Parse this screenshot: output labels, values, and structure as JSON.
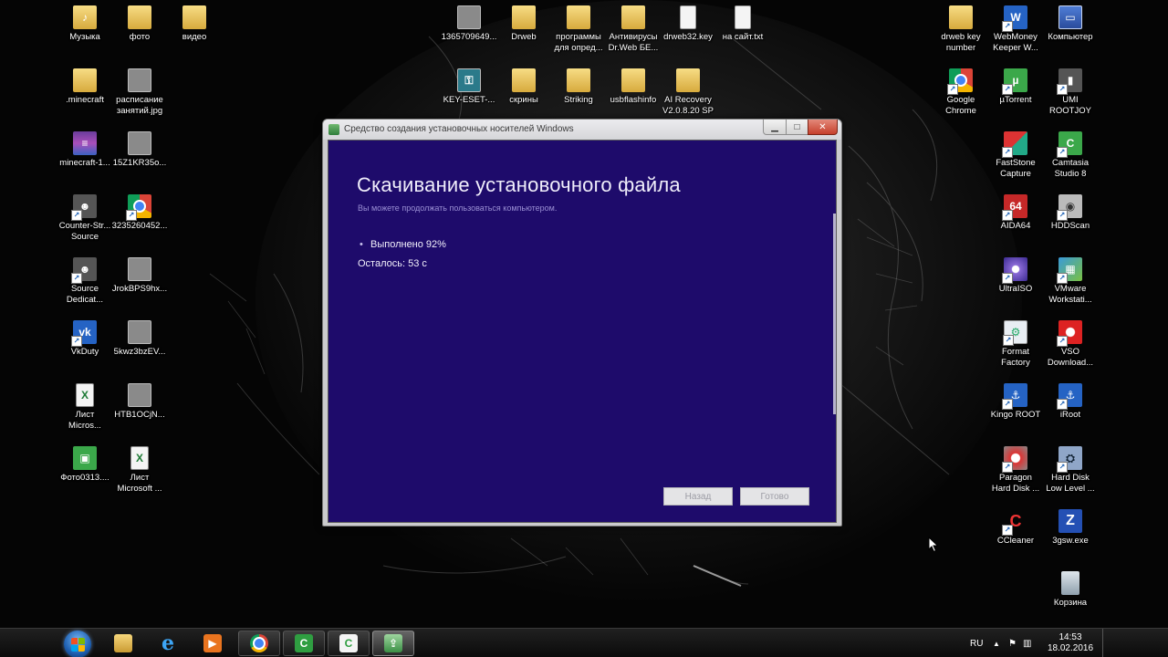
{
  "desktop": {
    "left_column_1": [
      {
        "label": "Музыка",
        "icon": "music-folder-icon"
      },
      {
        "label": ".minecraft",
        "icon": "folder-icon"
      },
      {
        "label": "minecraft-1...",
        "icon": "winrar-archive-icon"
      },
      {
        "label": "Counter-Str...\nSource",
        "icon": "counter-strike-icon"
      },
      {
        "label": "Source\nDedicat...",
        "icon": "source-dedicated-icon"
      },
      {
        "label": "VkDuty",
        "icon": "vkduty-icon"
      },
      {
        "label": "Лист\nMicros...",
        "icon": "excel-document-icon"
      },
      {
        "label": "Фото0313....",
        "icon": "photo-icon"
      }
    ],
    "left_column_2": [
      {
        "label": "фото",
        "icon": "photo-folder-icon"
      },
      {
        "label": "расписание\nзанятий.jpg",
        "icon": "image-file-icon"
      },
      {
        "label": "15Z1KR35o...",
        "icon": "image-file-icon"
      },
      {
        "label": "3235260452...",
        "icon": "chrome-shortcut-icon"
      },
      {
        "label": "JrokBPS9hx...",
        "icon": "image-file-icon"
      },
      {
        "label": "5kwz3bzEV...",
        "icon": "image-file-icon"
      },
      {
        "label": "HTB1OCjN...",
        "icon": "image-file-icon"
      },
      {
        "label": "Лист\nMicrosoft ...",
        "icon": "excel-document-icon"
      }
    ],
    "left_column_3": [
      {
        "label": "видео",
        "icon": "video-folder-icon"
      }
    ],
    "top_middle": [
      {
        "label": "1365709649...",
        "icon": "image-file-icon"
      },
      {
        "label": "Drweb",
        "icon": "folder-icon"
      },
      {
        "label": "программы\nдля опред...",
        "icon": "folder-icon"
      },
      {
        "label": "Антивирусы\nDr.Web БЕ...",
        "icon": "folder-icon"
      },
      {
        "label": "drweb32.key",
        "icon": "text-file-icon"
      },
      {
        "label": "на сайт.txt",
        "icon": "text-file-icon"
      }
    ],
    "top_middle_row2": [
      {
        "label": "KEY-ESET-...",
        "icon": "eset-key-icon"
      },
      {
        "label": "скрины",
        "icon": "folder-icon"
      },
      {
        "label": "Striking",
        "icon": "folder-icon"
      },
      {
        "label": "usbflashinfo",
        "icon": "folder-icon"
      },
      {
        "label": "AI Recovery\nV2.0.8.20 SP",
        "icon": "folder-icon"
      }
    ],
    "right_column_1": [
      {
        "label": "drweb key\nnumber",
        "icon": "folder-icon"
      },
      {
        "label": "Google\nChrome",
        "icon": "chrome-icon"
      }
    ],
    "right_column_2": [
      {
        "label": "WebMoney\nKeeper W...",
        "icon": "webmoney-icon"
      },
      {
        "label": "µTorrent",
        "icon": "utorrent-icon"
      },
      {
        "label": "FastStone\nCapture",
        "icon": "faststone-icon"
      },
      {
        "label": "AIDA64",
        "icon": "aida64-icon"
      },
      {
        "label": "UltraISO",
        "icon": "ultraiso-icon"
      },
      {
        "label": "Format\nFactory",
        "icon": "format-factory-icon"
      },
      {
        "label": "Kingo ROOT",
        "icon": "kingo-root-icon"
      },
      {
        "label": "Paragon\nHard Disk ...",
        "icon": "paragon-icon"
      },
      {
        "label": "CCleaner",
        "icon": "ccleaner-icon"
      }
    ],
    "right_column_3": [
      {
        "label": "Компьютер",
        "icon": "computer-icon"
      },
      {
        "label": "UMI\nROOTJOY",
        "icon": "umi-rootjoy-icon"
      },
      {
        "label": "Camtasia\nStudio 8",
        "icon": "camtasia-icon"
      },
      {
        "label": "HDDScan",
        "icon": "hddscan-icon"
      },
      {
        "label": "VMware\nWorkstati...",
        "icon": "vmware-icon"
      },
      {
        "label": "VSO\nDownload...",
        "icon": "vso-downloader-icon"
      },
      {
        "label": "iRoot",
        "icon": "iroot-icon"
      },
      {
        "label": "Hard Disk\nLow Level ...",
        "icon": "hdd-llf-icon"
      },
      {
        "label": "3gsw.exe",
        "icon": "exe-icon"
      },
      {
        "label": "Корзина",
        "icon": "recycle-bin-icon"
      }
    ]
  },
  "window": {
    "title": "Средство создания установочных носителей Windows",
    "heading": "Скачивание установочного файла",
    "subtitle": "Вы можете продолжать пользоваться компьютером.",
    "progress_text": "Выполнено 92%",
    "progress_percent": 92,
    "remaining_text": "Осталось: 53 с",
    "back_label": "Назад",
    "done_label": "Готово",
    "minimize_glyph": "▁",
    "maximize_glyph": "□",
    "close_glyph": "✕",
    "colors": {
      "client_bg": "#1e0b6b",
      "heading": "#f0eefb",
      "subtitle": "#9a8fd4"
    }
  },
  "taskbar": {
    "pinned": [
      {
        "name": "explorer-icon"
      },
      {
        "name": "internet-explorer-icon"
      },
      {
        "name": "media-player-icon"
      },
      {
        "name": "chrome-icon"
      },
      {
        "name": "camtasia-recorder-icon"
      },
      {
        "name": "camtasia-studio-icon"
      },
      {
        "name": "media-creation-tool-icon"
      }
    ],
    "language": "RU",
    "clock_time": "14:53",
    "clock_date": "18.02.2016"
  }
}
